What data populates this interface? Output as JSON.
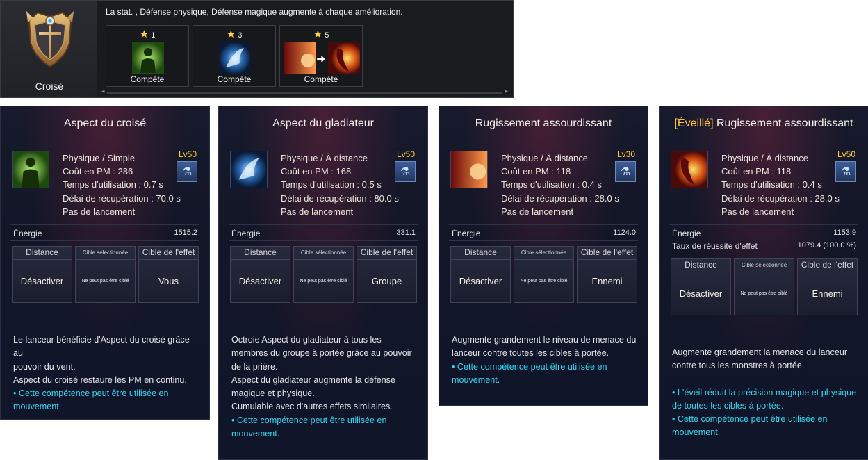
{
  "top_panel": {
    "class_name": "Croisé",
    "description": "La stat. , Défense physique, Défense magique augmente à chaque amélioration.",
    "slots": [
      {
        "stars": "1",
        "label": "Compéte"
      },
      {
        "stars": "3",
        "label": "Compéte"
      },
      {
        "stars": "5",
        "label": "Compéte"
      }
    ]
  },
  "cards": [
    {
      "title": "Aspect du croisé",
      "awaken_tag": "",
      "level": "Lv50",
      "stats": [
        "Physique / Simple",
        "Coût en PM : 286",
        "Temps d'utilisation : 0.7 s",
        "Délai de récupération : 70.0 s",
        "Pas de lancement"
      ],
      "energy_label": "Énergie",
      "energy_value": "1515.2",
      "effect_label": "",
      "effect_value": "",
      "boxes": [
        {
          "header": "Distance",
          "value": "Désactiver"
        },
        {
          "header": "Cible sélectionnée",
          "value": "Ne peut pas être ciblé"
        },
        {
          "header": "Cible de l'effet",
          "value": "Vous"
        }
      ],
      "desc": [
        "Le lanceur bénéficie d'Aspect du croisé grâce au",
        "pouvoir du vent.",
        "Aspect du croisé restaure les PM en continu."
      ],
      "note": [
        "• Cette compétence peut être utilisée en",
        "mouvement."
      ]
    },
    {
      "title": "Aspect du gladiateur",
      "awaken_tag": "",
      "level": "Lv50",
      "stats": [
        "Physique / À distance",
        "Coût en PM : 168",
        "Temps d'utilisation : 0.5 s",
        "Délai de récupération : 80.0 s",
        "Pas de lancement"
      ],
      "energy_label": "Énergie",
      "energy_value": "331.1",
      "effect_label": "",
      "effect_value": "",
      "boxes": [
        {
          "header": "Distance",
          "value": "Désactiver"
        },
        {
          "header": "Cible sélectionnée",
          "value": "Ne peut pas être ciblé"
        },
        {
          "header": "Cible de l'effet",
          "value": "Groupe"
        }
      ],
      "desc": [
        "Octroie Aspect du gladiateur à tous les",
        "membres du groupe à portée grâce au pouvoir",
        "de la prière.",
        "Aspect du gladiateur augmente la défense",
        "magique et physique.",
        "Cumulable avec d'autres effets similaires."
      ],
      "note": [
        "• Cette compétence peut être utilisée en",
        "mouvement."
      ]
    },
    {
      "title": "Rugissement assourdissant",
      "awaken_tag": "",
      "level": "Lv30",
      "stats": [
        "Physique / À distance",
        "Coût en PM : 118",
        "Temps d'utilisation : 0.4 s",
        "Délai de récupération : 28.0 s",
        "Pas de lancement"
      ],
      "energy_label": "Énergie",
      "energy_value": "1124.0",
      "effect_label": "",
      "effect_value": "",
      "boxes": [
        {
          "header": "Distance",
          "value": "Désactiver"
        },
        {
          "header": "Cible sélectionnée",
          "value": "Ne peut pas être ciblé"
        },
        {
          "header": "Cible de l'effet",
          "value": "Ennemi"
        }
      ],
      "desc": [
        "Augmente grandement le niveau de menace du",
        "lanceur contre toutes les cibles à portée."
      ],
      "note": [
        "• Cette compétence peut être utilisée en",
        "mouvement."
      ]
    },
    {
      "title": " Rugissement assourdissant",
      "awaken_tag": "[Éveillé]",
      "level": "Lv50",
      "stats": [
        "Physique / À distance",
        "Coût en PM : 118",
        "Temps d'utilisation : 0.4 s",
        "Délai de récupération : 28.0 s",
        "Pas de lancement"
      ],
      "energy_label": "Énergie",
      "energy_value": "1153.9",
      "effect_label": "Taux de réussite d'effet",
      "effect_value": "1079.4 (100.0 %)",
      "boxes": [
        {
          "header": "Distance",
          "value": "Désactiver"
        },
        {
          "header": "Cible sélectionnée",
          "value": "Ne peut pas être ciblé"
        },
        {
          "header": "Cible de l'effet",
          "value": "Ennemi"
        }
      ],
      "desc": [
        "Augmente grandement la menace du lanceur",
        "contre tous les monstres à portée."
      ],
      "note": [
        "• L'éveil réduit la précision magique et physique",
        "de toutes les cibles à portée.",
        "• Cette compétence peut être utilisée en",
        "mouvement."
      ]
    }
  ]
}
